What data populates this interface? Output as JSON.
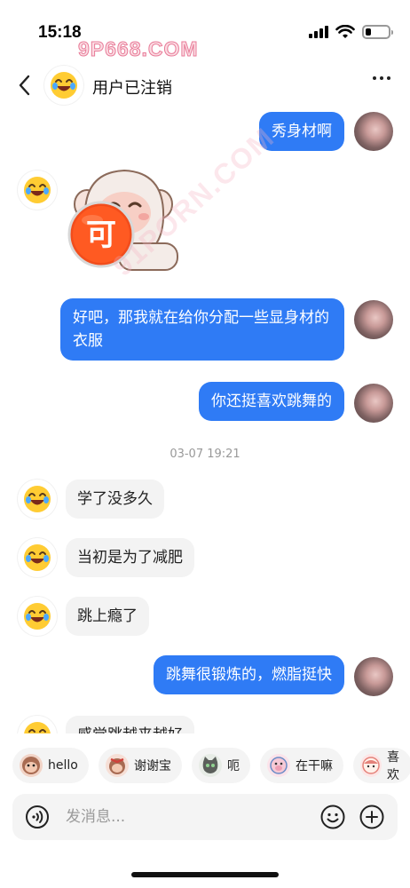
{
  "status_bar": {
    "time": "15:18",
    "icons": [
      "signal-icon",
      "wifi-icon",
      "battery-icon"
    ]
  },
  "watermark": {
    "top": "9P668.COM",
    "diagonal": "91PORN.COM"
  },
  "header": {
    "title": "用户已注销",
    "back_icon": "chevron-left-icon",
    "more_icon": "more-dots-icon"
  },
  "messages": [
    {
      "direction": "out",
      "text": "秀身材啊"
    },
    {
      "direction": "in",
      "type": "sticker",
      "sticker_text": "可"
    },
    {
      "direction": "out",
      "text": "好吧，那我就在给你分配一些显身材的衣服"
    },
    {
      "direction": "out",
      "text": "你还挺喜欢跳舞的"
    },
    {
      "type": "timestamp",
      "text": "03-07 19:21"
    },
    {
      "direction": "in",
      "text": "学了没多久"
    },
    {
      "direction": "in",
      "text": "当初是为了减肥"
    },
    {
      "direction": "in",
      "text": "跳上瘾了"
    },
    {
      "direction": "out",
      "text": "跳舞很锻炼的，燃脂挺快"
    },
    {
      "direction": "in",
      "text": "感觉跳越来越好"
    }
  ],
  "quick_replies": [
    {
      "label": "hello",
      "icon": "monkey-icon"
    },
    {
      "label": "谢谢宝",
      "icon": "monkey-bow-icon"
    },
    {
      "label": "呃",
      "icon": "cat-icon"
    },
    {
      "label": "在干嘛",
      "icon": "pig-icon"
    },
    {
      "label": "喜欢",
      "icon": "girl-icon"
    }
  ],
  "input": {
    "placeholder": "发消息...",
    "voice_icon": "voice-icon",
    "emoji_icon": "emoji-icon",
    "plus_icon": "plus-icon"
  },
  "colors": {
    "outgoing_bubble": "#2f7bf5",
    "incoming_bubble": "#f3f3f3",
    "watermark": "#e87b98"
  }
}
